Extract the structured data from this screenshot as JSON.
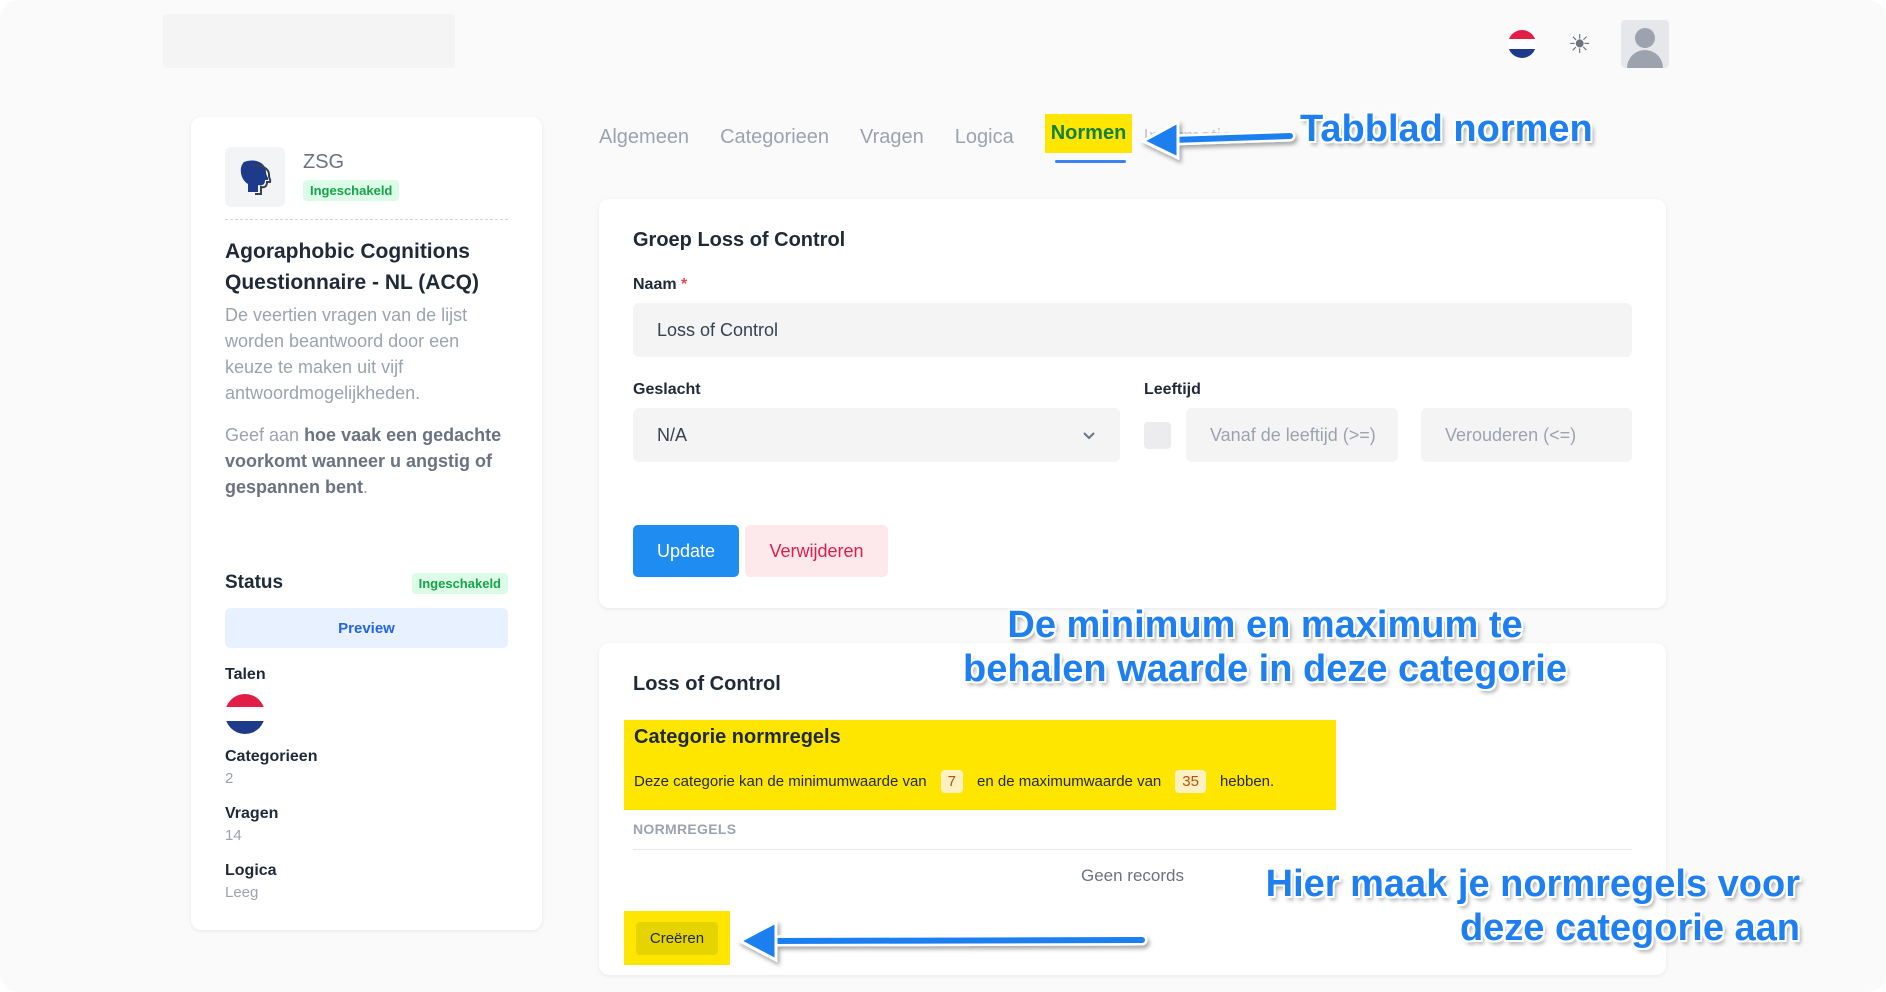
{
  "header": {
    "language_flag_icon": "flag-nl-icon",
    "theme_icon": "sun-icon",
    "avatar_icon": "user-avatar-icon"
  },
  "sidebar": {
    "app_name": "ZSG",
    "app_badge": "Ingeschakeld",
    "questionnaire_title": "Agoraphobic Cognitions Questionnaire - NL (ACQ)",
    "description": "De veertien vragen van de lijst worden beantwoord door een keuze te maken uit vijf antwoordmogelijkheden.",
    "instruction_prefix": "Geef aan ",
    "instruction_bold": "hoe vaak een gedachte voorkomt wanneer u angstig of gespannen bent",
    "instruction_suffix": ".",
    "status_label": "Status",
    "status_badge": "Ingeschakeld",
    "preview_label": "Preview",
    "languages_label": "Talen",
    "categories_label": "Categorieen",
    "categories_value": "2",
    "questions_label": "Vragen",
    "questions_value": "14",
    "logic_label": "Logica",
    "logic_value": "Leeg"
  },
  "tabs": [
    {
      "label": "Algemeen"
    },
    {
      "label": "Categorieen"
    },
    {
      "label": "Vragen"
    },
    {
      "label": "Logica"
    },
    {
      "label": "Normen"
    },
    {
      "label": "Informatie"
    }
  ],
  "group_form": {
    "title": "Groep Loss of Control",
    "name_label": "Naam",
    "name_required": "*",
    "name_value": "Loss of Control",
    "gender_label": "Geslacht",
    "gender_value": "N/A",
    "age_label": "Leeftijd",
    "age_from_placeholder": "Vanaf de leeftijd (>=)",
    "age_to_placeholder": "Verouderen (<=)",
    "update_label": "Update",
    "delete_label": "Verwijderen"
  },
  "norms_card": {
    "title": "Loss of Control",
    "rules_heading": "Categorie normregels",
    "rules_text_1": "Deze categorie kan de minimumwaarde van",
    "min_value": "7",
    "rules_text_2": "en de maximumwaarde van",
    "max_value": "35",
    "rules_text_3": "hebben.",
    "section_label": "NORMREGELS",
    "empty_text": "Geen records",
    "create_label": "Creëren"
  },
  "annotations": {
    "tab_note": "Tabblad normen",
    "range_note_line1": "De minimum en maximum te",
    "range_note_line2": "behalen waarde in deze categorie",
    "create_note_line1": "Hier maak je normregels voor",
    "create_note_line2": "deze categorie aan",
    "color": "#1e7ff0",
    "highlight_color": "#ffe600"
  }
}
